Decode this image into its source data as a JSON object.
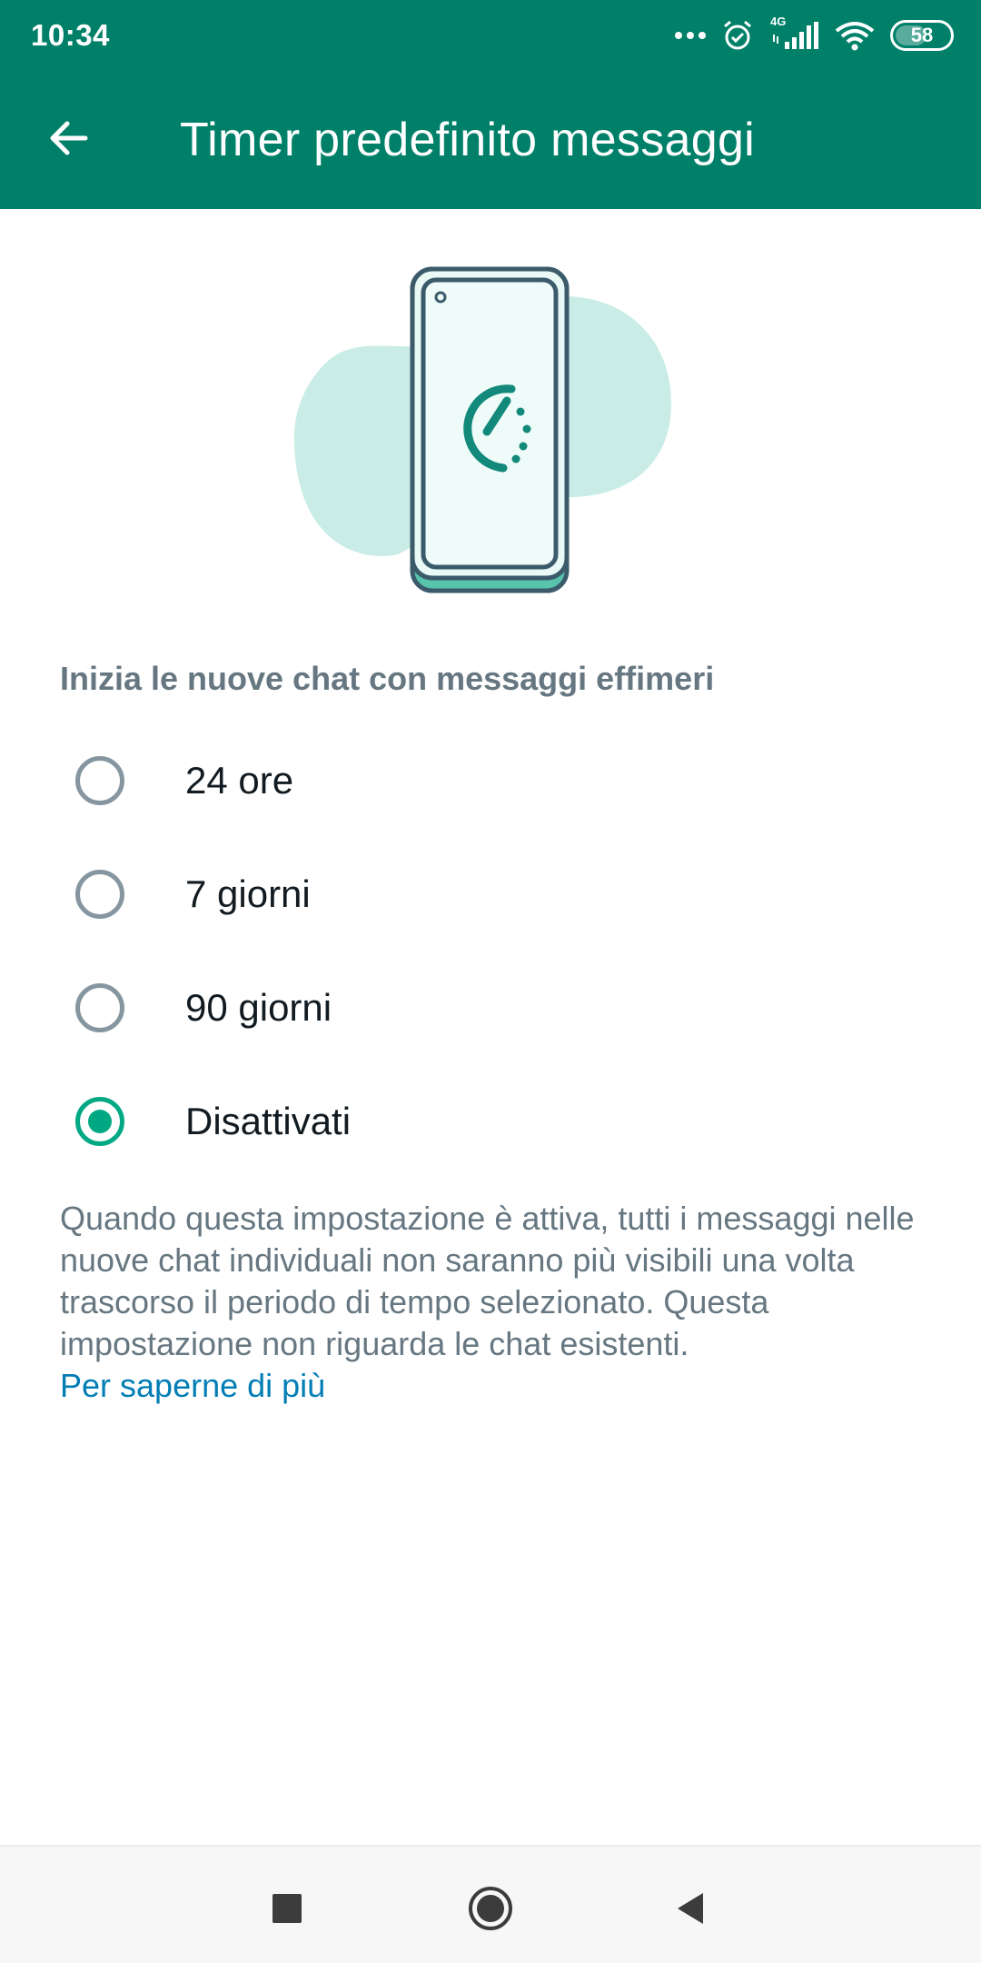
{
  "status_bar": {
    "time": "10:34",
    "network": "4G",
    "battery": "58"
  },
  "app_bar": {
    "title": "Timer predefinito messaggi",
    "back_icon": "arrow-left-icon"
  },
  "section": {
    "header": "Inizia le nuove chat con messaggi effimeri"
  },
  "options": [
    {
      "label": "24 ore",
      "selected": false
    },
    {
      "label": "7 giorni",
      "selected": false
    },
    {
      "label": "90 giorni",
      "selected": false
    },
    {
      "label": "Disattivati",
      "selected": true
    }
  ],
  "description": {
    "text": "Quando questa impostazione è attiva, tutti i messaggi nelle nuove chat individuali non saranno più visibili una volta trascorso il periodo di tempo selezionato. Questa impostazione non riguarda le chat esistenti.",
    "link": "Per saperne di più"
  },
  "colors": {
    "primary": "#008069",
    "accent": "#00a884",
    "link": "#027eb5",
    "secondary_text": "#667781"
  },
  "nav_bar": {
    "recents_icon": "square-icon",
    "home_icon": "circle-home-icon",
    "back_icon": "triangle-back-icon"
  }
}
